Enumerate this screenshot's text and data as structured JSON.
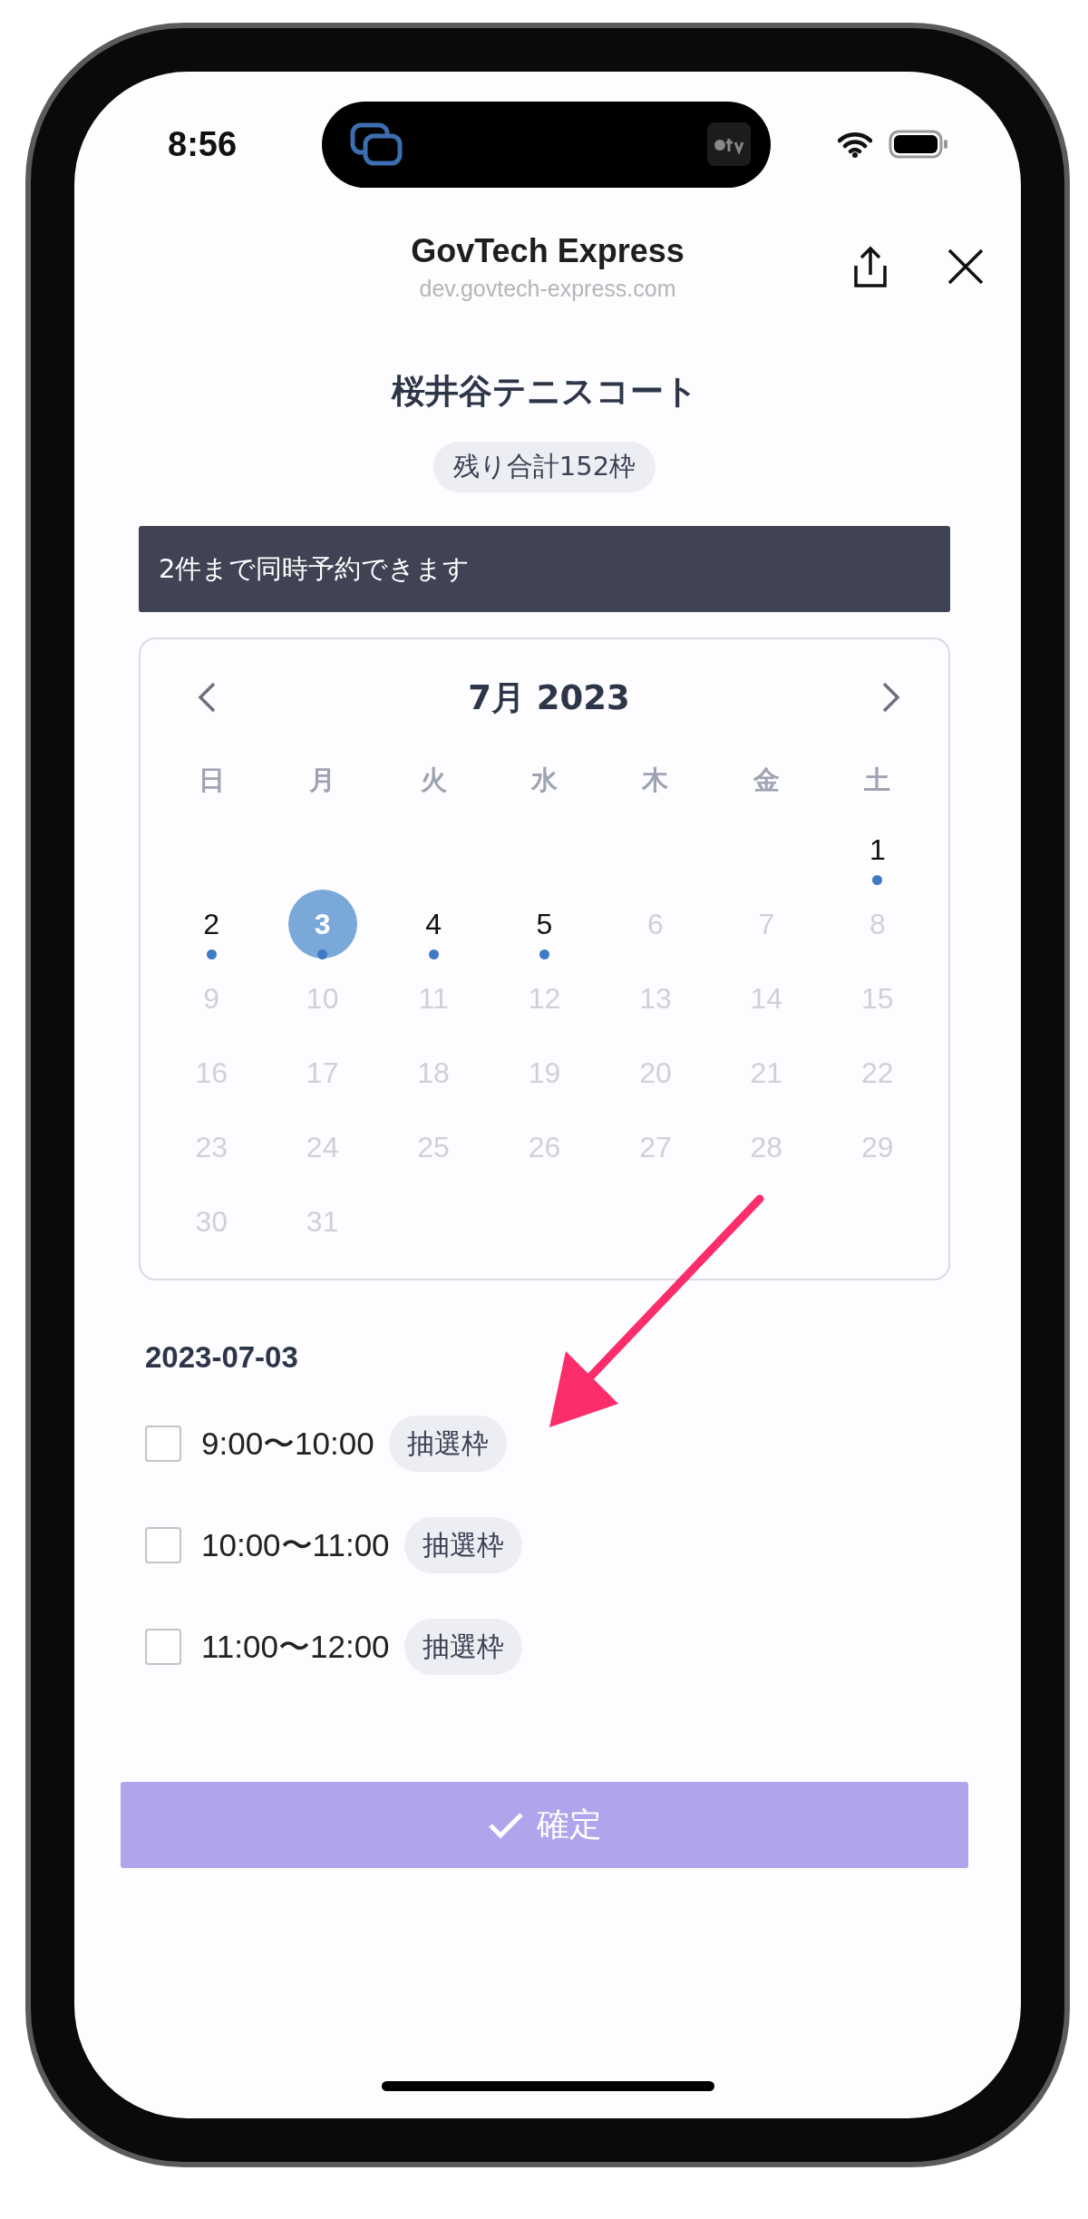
{
  "status_bar": {
    "time": "8:56"
  },
  "browser": {
    "title": "GovTech Express",
    "url": "dev.govtech-express.com"
  },
  "venue": {
    "name": "桜井谷テニスコート",
    "remaining": "残り合計152枠"
  },
  "notice": "2件まで同時予約できます",
  "calendar": {
    "month": "7月 2023",
    "weekdays": [
      "日",
      "月",
      "火",
      "水",
      "木",
      "金",
      "土"
    ],
    "weeks": [
      {
        "days": [
          {
            "day": "1",
            "available": true,
            "selected": false
          }
        ]
      },
      {
        "days": [
          {
            "day": "2",
            "available": true,
            "selected": false
          },
          {
            "day": "3",
            "available": true,
            "selected": true
          },
          {
            "day": "4",
            "available": true,
            "selected": false
          },
          {
            "day": "5",
            "available": true,
            "selected": false
          },
          {
            "day": "6",
            "available": false,
            "selected": false
          },
          {
            "day": "7",
            "available": false,
            "selected": false
          },
          {
            "day": "8",
            "available": false,
            "selected": false
          }
        ]
      },
      {
        "days": [
          {
            "day": "9",
            "available": false,
            "selected": false
          },
          {
            "day": "10",
            "available": false,
            "selected": false
          },
          {
            "day": "11",
            "available": false,
            "selected": false
          },
          {
            "day": "12",
            "available": false,
            "selected": false
          },
          {
            "day": "13",
            "available": false,
            "selected": false
          },
          {
            "day": "14",
            "available": false,
            "selected": false
          },
          {
            "day": "15",
            "available": false,
            "selected": false
          }
        ]
      },
      {
        "days": [
          {
            "day": "16",
            "available": false,
            "selected": false
          },
          {
            "day": "17",
            "available": false,
            "selected": false
          },
          {
            "day": "18",
            "available": false,
            "selected": false
          },
          {
            "day": "19",
            "available": false,
            "selected": false
          },
          {
            "day": "20",
            "available": false,
            "selected": false
          },
          {
            "day": "21",
            "available": false,
            "selected": false
          },
          {
            "day": "22",
            "available": false,
            "selected": false
          }
        ]
      },
      {
        "days": [
          {
            "day": "23",
            "available": false,
            "selected": false
          },
          {
            "day": "24",
            "available": false,
            "selected": false
          },
          {
            "day": "25",
            "available": false,
            "selected": false
          },
          {
            "day": "26",
            "available": false,
            "selected": false
          },
          {
            "day": "27",
            "available": false,
            "selected": false
          },
          {
            "day": "28",
            "available": false,
            "selected": false
          },
          {
            "day": "29",
            "available": false,
            "selected": false
          }
        ]
      },
      {
        "days": [
          {
            "day": "30",
            "available": false,
            "selected": false
          },
          {
            "day": "31",
            "available": false,
            "selected": false
          }
        ]
      }
    ]
  },
  "selected_date": "2023-07-03",
  "slots": [
    {
      "time": "9:00〜10:00",
      "tag": "抽選枠",
      "checked": false
    },
    {
      "time": "10:00〜11:00",
      "tag": "抽選枠",
      "checked": false
    },
    {
      "time": "11:00〜12:00",
      "tag": "抽選枠",
      "checked": false
    }
  ],
  "confirm_button": {
    "label": "確定",
    "disabled": true
  }
}
